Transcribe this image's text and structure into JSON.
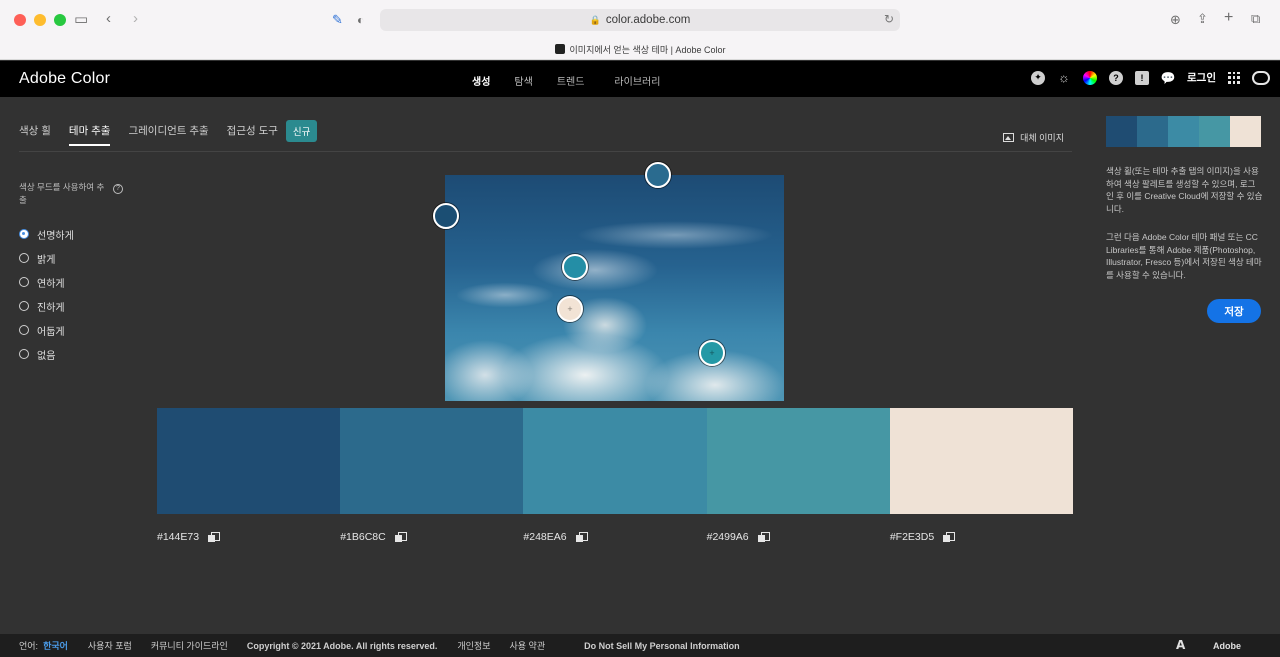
{
  "browser": {
    "url": "color.adobe.com",
    "tab_title": "이미지에서 얻는 색상 테마 | Adobe Color"
  },
  "header": {
    "brand": "Adobe Color",
    "nav": [
      {
        "label": "생성",
        "active": true
      },
      {
        "label": "탐색",
        "active": false
      },
      {
        "label": "트렌드",
        "active": false
      },
      {
        "label": "라이브러리",
        "active": false
      }
    ],
    "login": "로그인",
    "icons": [
      "community-icon",
      "brightness-icon",
      "color-wheel-icon",
      "help-icon",
      "feedback-icon",
      "chat-icon",
      "apps-grid-icon",
      "creative-cloud-icon"
    ]
  },
  "subtabs": [
    {
      "label": "색상 휠",
      "active": false
    },
    {
      "label": "테마 추출",
      "active": true
    },
    {
      "label": "그레이디언트 추출",
      "active": false
    },
    {
      "label": "접근성 도구",
      "active": false
    }
  ],
  "new_badge": "신규",
  "alt_image": "대체 이미지",
  "mood": {
    "title": "색상 무드를 사용하여 추출",
    "options": [
      {
        "label": "선명하게",
        "selected": true
      },
      {
        "label": "밝게",
        "selected": false
      },
      {
        "label": "연하게",
        "selected": false
      },
      {
        "label": "진하게",
        "selected": false
      },
      {
        "label": "어둡게",
        "selected": false
      },
      {
        "label": "없음",
        "selected": false
      }
    ]
  },
  "pickers": [
    {
      "color": "#1b4e73"
    },
    {
      "color": "#2a6b8f"
    },
    {
      "color": "#248ea6"
    },
    {
      "color": "#f2e3d5"
    },
    {
      "color": "#2499a6"
    }
  ],
  "swatches": [
    {
      "hex": "#144E73",
      "color": "#1f4c72"
    },
    {
      "hex": "#1B6C8C",
      "color": "#2c6a8c"
    },
    {
      "hex": "#248EA6",
      "color": "#3c8ba5"
    },
    {
      "hex": "#2499A6",
      "color": "#4697a4"
    },
    {
      "hex": "#F2E3D5",
      "color": "#efe2d6"
    }
  ],
  "sidebar": {
    "desc1": "색상 휠(또는 테마 추출 탭의 이미지)을 사용하여 색상 팔레트를 생성할 수 있으며, 로그인 후 이를 Creative Cloud에 저장할 수 있습니다.",
    "desc2": "그런 다음 Adobe Color 테마 패널 또는 CC Libraries를 통해 Adobe 제품(Photoshop, Illustrator, Fresco 등)에서 저장된 색상 테마를 사용할 수 있습니다.",
    "save_label": "저장"
  },
  "footer": {
    "lang_label": "언어:",
    "lang_value": "한국어",
    "forum": "사용자 포럼",
    "guidelines": "커뮤니티 가이드라인",
    "copyright": "Copyright © 2021 Adobe. All rights reserved.",
    "privacy": "개인정보",
    "terms": "사용 약관",
    "dns": "Do Not Sell My Personal Information",
    "adobe": "Adobe"
  }
}
